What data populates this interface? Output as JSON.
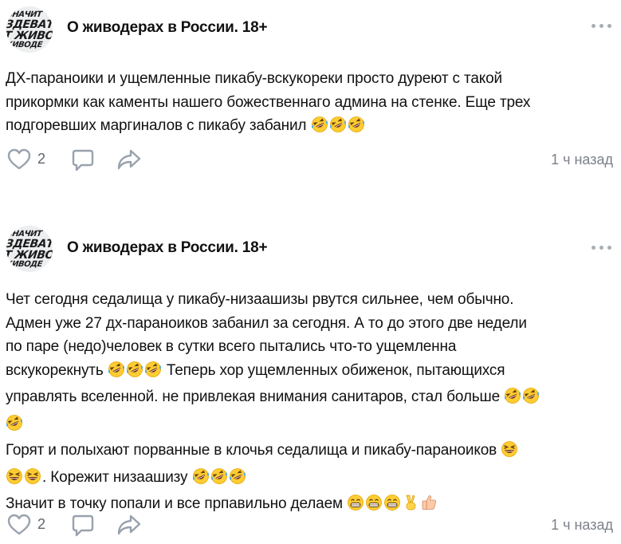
{
  "posts": [
    {
      "avatar_lines": [
        "ЗНАЧИТ",
        "ЗДЕВАТЕ",
        "Т ЖИВО",
        "ЖИВОДЕ"
      ],
      "group_name": "О живодерах в России. 18+",
      "text_segments": [
        {
          "text": "ДХ-параноики и ущемленные пикабу-вскукореки просто дуреют с такой\nприкормки как каменты нашего божественнагo админа на стенке. Еще трех\nподгоревших маргиналов с пикабу забанил "
        },
        {
          "emoji": [
            "rofl",
            "rofl",
            "rofl"
          ]
        }
      ],
      "likes": "2",
      "time": "1 ч назад"
    },
    {
      "avatar_lines": [
        "ЗНАЧИТ",
        "ЗДЕВАТЕ",
        "Т ЖИВО",
        "ЖИВОДЕ"
      ],
      "group_name": "О живодерах в России. 18+",
      "text_segments": [
        {
          "text": "Чет сегодня седалища у пикабу-низаашизы рвутся сильнее, чем обычно.\nАдмен уже 27 дх-параноиков забанил за сегодня. А то до этого две недели\nпо паре (недо)человек в сутки всего пытались что-то ущемленна\nвскукорекнуть "
        },
        {
          "emoji": [
            "rofl",
            "rofl",
            "rofl"
          ]
        },
        {
          "text": " Теперь хор ущемленных обиженок, пытающихся\nуправлять вселенной. не привлекая внимания санитаров, стал больше "
        },
        {
          "emoji": [
            "rofl",
            "rofl"
          ]
        },
        {
          "text": "\n"
        },
        {
          "emoji": [
            "rofl"
          ]
        },
        {
          "text": "\nГорят и полыхают порванные в клочья седалища и пикабу-параноиков "
        },
        {
          "emoji": [
            "laughing"
          ]
        },
        {
          "text": "\n"
        },
        {
          "emoji": [
            "laughing",
            "laughing"
          ]
        },
        {
          "text": ". Корежит низаашизу "
        },
        {
          "emoji": [
            "rofl",
            "rofl",
            "rofl"
          ]
        },
        {
          "text": "\nЗначит в точку попали и все прпавильно делаем "
        },
        {
          "emoji": [
            "grin",
            "grin",
            "grin",
            "victory",
            "thumbs-up"
          ]
        }
      ],
      "likes": "2",
      "time": "1 ч назад"
    }
  ],
  "colors": {
    "text": "#111111",
    "icon": "#99a2ad",
    "secondary": "#7b818a",
    "emoji_face": "#ffcc33",
    "tears": "#4aa8f0"
  },
  "icons": {
    "like": "heart-outline-icon",
    "comment": "comment-bubble-icon",
    "share": "share-arrow-icon",
    "more": "more-horizontal-icon"
  }
}
